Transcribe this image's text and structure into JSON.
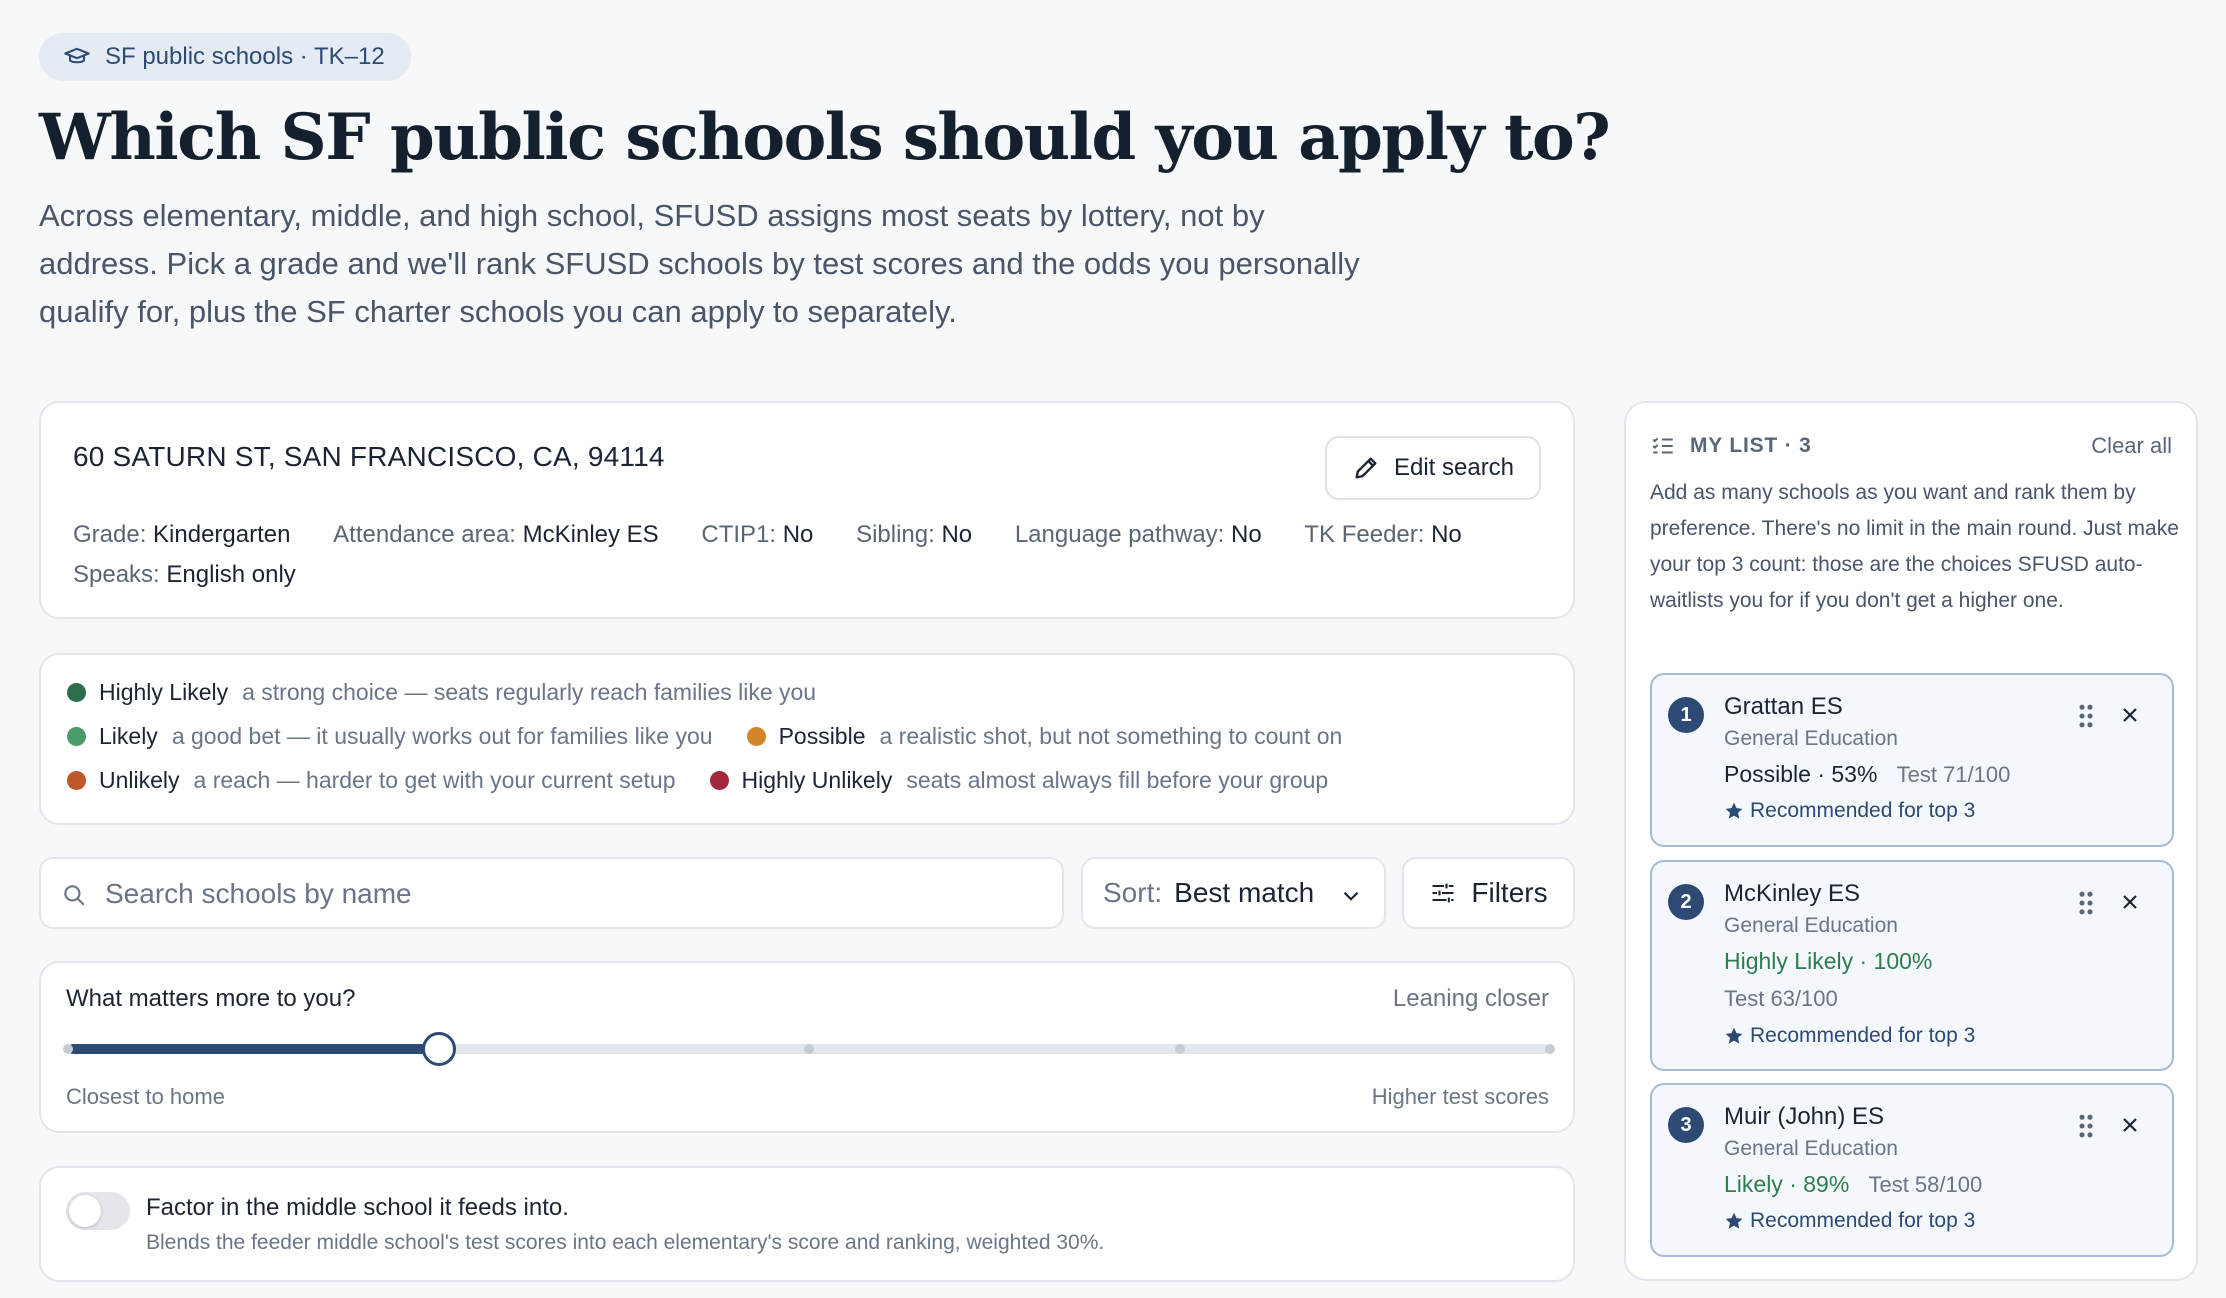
{
  "badge": {
    "label": "SF public schools · TK–12",
    "icon": "graduation-cap-icon"
  },
  "page_title": "Which SF public schools should you apply to?",
  "intro": "Across elementary, middle, and high school, SFUSD assigns most seats by lottery, not by address. Pick a grade and we'll rank SFUSD schools by test scores and the odds you personally qualify for, plus the SF charter schools you can apply to separately.",
  "address_card": {
    "address": "60 SATURN ST, SAN FRANCISCO, CA, 94114",
    "edit_button": "Edit search",
    "fields": [
      {
        "label": "Grade:",
        "value": "Kindergarten"
      },
      {
        "label": "Attendance area:",
        "value": "McKinley ES"
      },
      {
        "label": "CTIP1:",
        "value": "No"
      },
      {
        "label": "Sibling:",
        "value": "No"
      },
      {
        "label": "Language pathway:",
        "value": "No"
      },
      {
        "label": "TK Feeder:",
        "value": "No"
      },
      {
        "label": "Speaks:",
        "value": "English only"
      }
    ]
  },
  "legend": [
    {
      "name": "Highly Likely",
      "desc": "a strong choice — seats regularly reach families like you",
      "color": "#2e6e4d"
    },
    {
      "name": "Likely",
      "desc": "a good bet — it usually works out for families like you",
      "color": "#4a9a6a"
    },
    {
      "name": "Possible",
      "desc": "a realistic shot, but not something to count on",
      "color": "#d48529"
    },
    {
      "name": "Unlikely",
      "desc": "a reach — harder to get with your current setup",
      "color": "#c0562a"
    },
    {
      "name": "Highly Unlikely",
      "desc": "seats almost always fill before your group",
      "color": "#a3283c"
    }
  ],
  "search": {
    "placeholder": "Search schools by name"
  },
  "sort": {
    "label": "Sort:",
    "value": "Best match"
  },
  "filters_label": "Filters",
  "preference": {
    "question": "What matters more to you?",
    "status": "Leaning closer",
    "left_label": "Closest to home",
    "right_label": "Higher test scores",
    "value": 0.25
  },
  "feeder_toggle": {
    "title": "Factor in the middle school it feeds into.",
    "description": "Blends the feeder middle school's test scores into each elementary's score and ranking, weighted 30%.",
    "enabled": false
  },
  "my_list": {
    "header": "MY LIST · 3",
    "clear_all": "Clear all",
    "intro": "Add as many schools as you want and rank them by preference. There's no limit in the main round. Just make your top 3 count: those are the choices SFUSD auto-waitlists you for if you don't get a higher one.",
    "items": [
      {
        "rank": "1",
        "name": "Grattan ES",
        "program": "General Education",
        "odds": "Possible",
        "pct": " · 53%",
        "test": "Test 71/100",
        "rec": "Recommended for top 3",
        "odds_color": "#1c2433"
      },
      {
        "rank": "2",
        "name": "McKinley ES",
        "program": "General Education",
        "odds": "Highly Likely",
        "pct": " · 100%",
        "test": "Test 63/100",
        "rec": "Recommended for top 3",
        "odds_color": "#2e7d4f"
      },
      {
        "rank": "3",
        "name": "Muir (John) ES",
        "program": "General Education",
        "odds": "Likely",
        "pct": " · 89%",
        "test": "Test 58/100",
        "rec": "Recommended for top 3",
        "odds_color": "#2e7d4f"
      }
    ]
  }
}
